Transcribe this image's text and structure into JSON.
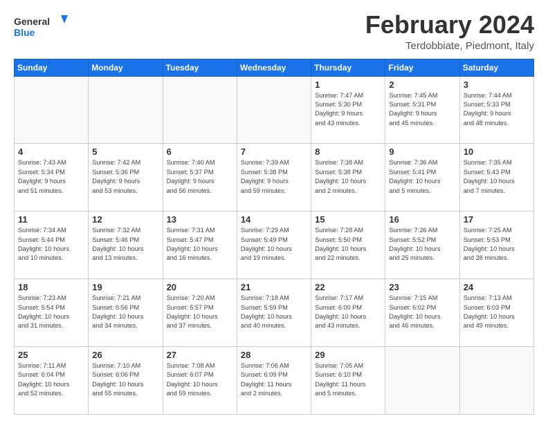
{
  "header": {
    "logo_general": "General",
    "logo_blue": "Blue",
    "title": "February 2024",
    "subtitle": "Terdobbiate, Piedmont, Italy"
  },
  "calendar": {
    "days_of_week": [
      "Sunday",
      "Monday",
      "Tuesday",
      "Wednesday",
      "Thursday",
      "Friday",
      "Saturday"
    ],
    "weeks": [
      [
        {
          "day": "",
          "info": ""
        },
        {
          "day": "",
          "info": ""
        },
        {
          "day": "",
          "info": ""
        },
        {
          "day": "",
          "info": ""
        },
        {
          "day": "1",
          "info": "Sunrise: 7:47 AM\nSunset: 5:30 PM\nDaylight: 9 hours\nand 43 minutes."
        },
        {
          "day": "2",
          "info": "Sunrise: 7:45 AM\nSunset: 5:31 PM\nDaylight: 9 hours\nand 45 minutes."
        },
        {
          "day": "3",
          "info": "Sunrise: 7:44 AM\nSunset: 5:33 PM\nDaylight: 9 hours\nand 48 minutes."
        }
      ],
      [
        {
          "day": "4",
          "info": "Sunrise: 7:43 AM\nSunset: 5:34 PM\nDaylight: 9 hours\nand 51 minutes."
        },
        {
          "day": "5",
          "info": "Sunrise: 7:42 AM\nSunset: 5:36 PM\nDaylight: 9 hours\nand 53 minutes."
        },
        {
          "day": "6",
          "info": "Sunrise: 7:40 AM\nSunset: 5:37 PM\nDaylight: 9 hours\nand 56 minutes."
        },
        {
          "day": "7",
          "info": "Sunrise: 7:39 AM\nSunset: 5:38 PM\nDaylight: 9 hours\nand 59 minutes."
        },
        {
          "day": "8",
          "info": "Sunrise: 7:38 AM\nSunset: 5:38 PM\nDaylight: 10 hours\nand 2 minutes."
        },
        {
          "day": "9",
          "info": "Sunrise: 7:36 AM\nSunset: 5:41 PM\nDaylight: 10 hours\nand 5 minutes."
        },
        {
          "day": "10",
          "info": "Sunrise: 7:35 AM\nSunset: 5:43 PM\nDaylight: 10 hours\nand 7 minutes."
        }
      ],
      [
        {
          "day": "11",
          "info": "Sunrise: 7:34 AM\nSunset: 5:44 PM\nDaylight: 10 hours\nand 10 minutes."
        },
        {
          "day": "12",
          "info": "Sunrise: 7:32 AM\nSunset: 5:46 PM\nDaylight: 10 hours\nand 13 minutes."
        },
        {
          "day": "13",
          "info": "Sunrise: 7:31 AM\nSunset: 5:47 PM\nDaylight: 10 hours\nand 16 minutes."
        },
        {
          "day": "14",
          "info": "Sunrise: 7:29 AM\nSunset: 5:49 PM\nDaylight: 10 hours\nand 19 minutes."
        },
        {
          "day": "15",
          "info": "Sunrise: 7:28 AM\nSunset: 5:50 PM\nDaylight: 10 hours\nand 22 minutes."
        },
        {
          "day": "16",
          "info": "Sunrise: 7:26 AM\nSunset: 5:52 PM\nDaylight: 10 hours\nand 25 minutes."
        },
        {
          "day": "17",
          "info": "Sunrise: 7:25 AM\nSunset: 5:53 PM\nDaylight: 10 hours\nand 28 minutes."
        }
      ],
      [
        {
          "day": "18",
          "info": "Sunrise: 7:23 AM\nSunset: 5:54 PM\nDaylight: 10 hours\nand 31 minutes."
        },
        {
          "day": "19",
          "info": "Sunrise: 7:21 AM\nSunset: 5:56 PM\nDaylight: 10 hours\nand 34 minutes."
        },
        {
          "day": "20",
          "info": "Sunrise: 7:20 AM\nSunset: 5:57 PM\nDaylight: 10 hours\nand 37 minutes."
        },
        {
          "day": "21",
          "info": "Sunrise: 7:18 AM\nSunset: 5:59 PM\nDaylight: 10 hours\nand 40 minutes."
        },
        {
          "day": "22",
          "info": "Sunrise: 7:17 AM\nSunset: 6:00 PM\nDaylight: 10 hours\nand 43 minutes."
        },
        {
          "day": "23",
          "info": "Sunrise: 7:15 AM\nSunset: 6:02 PM\nDaylight: 10 hours\nand 46 minutes."
        },
        {
          "day": "24",
          "info": "Sunrise: 7:13 AM\nSunset: 6:03 PM\nDaylight: 10 hours\nand 49 minutes."
        }
      ],
      [
        {
          "day": "25",
          "info": "Sunrise: 7:11 AM\nSunset: 6:04 PM\nDaylight: 10 hours\nand 52 minutes."
        },
        {
          "day": "26",
          "info": "Sunrise: 7:10 AM\nSunset: 6:06 PM\nDaylight: 10 hours\nand 55 minutes."
        },
        {
          "day": "27",
          "info": "Sunrise: 7:08 AM\nSunset: 6:07 PM\nDaylight: 10 hours\nand 59 minutes."
        },
        {
          "day": "28",
          "info": "Sunrise: 7:06 AM\nSunset: 6:09 PM\nDaylight: 11 hours\nand 2 minutes."
        },
        {
          "day": "29",
          "info": "Sunrise: 7:05 AM\nSunset: 6:10 PM\nDaylight: 11 hours\nand 5 minutes."
        },
        {
          "day": "",
          "info": ""
        },
        {
          "day": "",
          "info": ""
        }
      ]
    ]
  }
}
